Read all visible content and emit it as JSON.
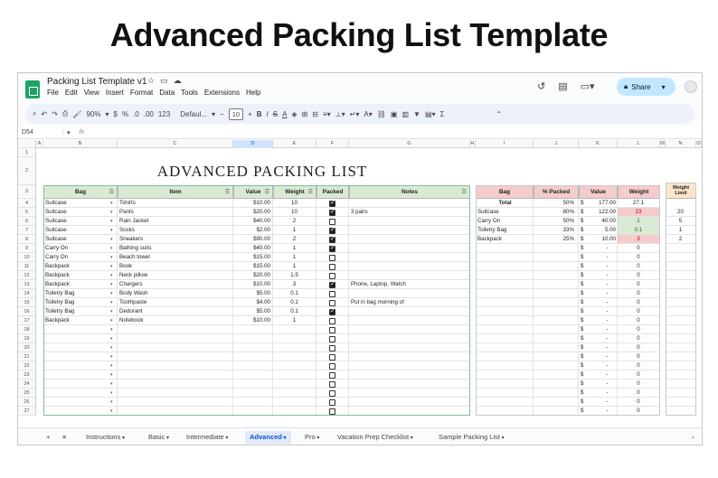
{
  "banner_title": "Advanced Packing List Template",
  "app": {
    "doc_title": "Packing List Template v1",
    "menu": [
      "File",
      "Edit",
      "View",
      "Insert",
      "Format",
      "Data",
      "Tools",
      "Extensions",
      "Help"
    ],
    "share_label": "Share",
    "toolbar": {
      "zoom": "90%",
      "currency": "$",
      "percent": "%",
      "dec_minus": ".0",
      "dec_plus": ".00",
      "num_format": "123",
      "font": "Defaul...",
      "font_size": "10",
      "bold": "B",
      "italic": "I",
      "strike": "S",
      "text_color": "A"
    },
    "cell_ref": "D54",
    "fx": "fx"
  },
  "columns": [
    "A",
    "B",
    "C",
    "D",
    "E",
    "F",
    "G",
    "H",
    "I",
    "J",
    "K",
    "L",
    "M",
    "N",
    "O"
  ],
  "sheet_title": "ADVANCED PACKING LIST",
  "main_headers": {
    "bag": "Bag",
    "item": "Item",
    "value": "Value",
    "weight": "Weight",
    "packed": "Packed",
    "notes": "Notes"
  },
  "main_rows": [
    {
      "row": "4",
      "bag": "Suitcase",
      "item": "Tshirts",
      "value": "$10.00",
      "weight": "10",
      "packed": true,
      "notes": ""
    },
    {
      "row": "5",
      "bag": "Suitcase",
      "item": "Pants",
      "value": "$20.00",
      "weight": "10",
      "packed": true,
      "notes": "3 pairs"
    },
    {
      "row": "6",
      "bag": "Suitcase",
      "item": "Rain Jacket",
      "value": "$40.00",
      "weight": "2",
      "packed": false,
      "notes": ""
    },
    {
      "row": "7",
      "bag": "Suitcase",
      "item": "Socks",
      "value": "$2.00",
      "weight": "1",
      "packed": true,
      "notes": ""
    },
    {
      "row": "8",
      "bag": "Suitcase",
      "item": "Sneakers",
      "value": "$90.00",
      "weight": "2",
      "packed": true,
      "notes": ""
    },
    {
      "row": "9",
      "bag": "Carry On",
      "item": "Bathing suits",
      "value": "$40.00",
      "weight": "1",
      "packed": true,
      "notes": ""
    },
    {
      "row": "10",
      "bag": "Carry On",
      "item": "Beach towel",
      "value": "$15.00",
      "weight": "1",
      "packed": false,
      "notes": ""
    },
    {
      "row": "11",
      "bag": "Backpack",
      "item": "Book",
      "value": "$15.00",
      "weight": "1",
      "packed": false,
      "notes": ""
    },
    {
      "row": "12",
      "bag": "Backpack",
      "item": "Neck pillow",
      "value": "$20.00",
      "weight": "1.5",
      "packed": false,
      "notes": ""
    },
    {
      "row": "13",
      "bag": "Backpack",
      "item": "Chargers",
      "value": "$10.00",
      "weight": "3",
      "packed": true,
      "notes": "Phone, Laptop, Watch"
    },
    {
      "row": "14",
      "bag": "Toiletry Bag",
      "item": "Body Wash",
      "value": "$5.00",
      "weight": "0.1",
      "packed": false,
      "notes": ""
    },
    {
      "row": "15",
      "bag": "Toiletry Bag",
      "item": "Toothpaste",
      "value": "$4.00",
      "weight": "0.1",
      "packed": false,
      "notes": "Put in bag morning of"
    },
    {
      "row": "16",
      "bag": "Toiletry Bag",
      "item": "Dedorant",
      "value": "$5.00",
      "weight": "0.1",
      "packed": true,
      "notes": ""
    },
    {
      "row": "17",
      "bag": "Backpack",
      "item": "Notebook",
      "value": "$10.00",
      "weight": "1",
      "packed": false,
      "notes": ""
    }
  ],
  "empty_rows": [
    "18",
    "19",
    "20",
    "21",
    "22",
    "23",
    "24",
    "25",
    "26",
    "27"
  ],
  "summary_headers": {
    "bag": "Bag",
    "pct": "% Packed",
    "value": "Value",
    "weight": "Weight",
    "limit": "Weight Limit"
  },
  "summary_total": {
    "bag": "Total",
    "pct": "50%",
    "cur": "$",
    "value": "177.00",
    "weight": "27.1"
  },
  "summary_rows": [
    {
      "bag": "Suitcase",
      "pct": "80%",
      "cur": "$",
      "value": "122.00",
      "weight": "23",
      "limit": "20",
      "status": "over"
    },
    {
      "bag": "Carry On",
      "pct": "50%",
      "cur": "$",
      "value": "40.00",
      "weight": "1",
      "limit": "5",
      "status": "ok"
    },
    {
      "bag": "Toiletry Bag",
      "pct": "33%",
      "cur": "$",
      "value": "5.00",
      "weight": "0.1",
      "limit": "1",
      "status": "ok"
    },
    {
      "bag": "Backpack",
      "pct": "25%",
      "cur": "$",
      "value": "10.00",
      "weight": "3",
      "limit": "2",
      "status": "over"
    }
  ],
  "summary_empty": {
    "cur": "$",
    "value": "-",
    "weight": "0",
    "count": 19
  },
  "tabs": [
    {
      "label": "Instructions",
      "active": false
    },
    {
      "label": "Basic",
      "active": false
    },
    {
      "label": "Intermediate",
      "active": false
    },
    {
      "label": "Advanced",
      "active": true
    },
    {
      "label": "Pro",
      "active": false
    },
    {
      "label": "Vacation Prep Checklist",
      "active": false
    },
    {
      "label": "Sample Packing List",
      "active": false
    }
  ],
  "colors": {
    "green_header": "#d9ead3",
    "red_header": "#f4cccc",
    "orange_limit": "#fce5cd",
    "over": "#f4cccc",
    "ok": "#d9ead3",
    "active_tab": "#0b57d0"
  }
}
